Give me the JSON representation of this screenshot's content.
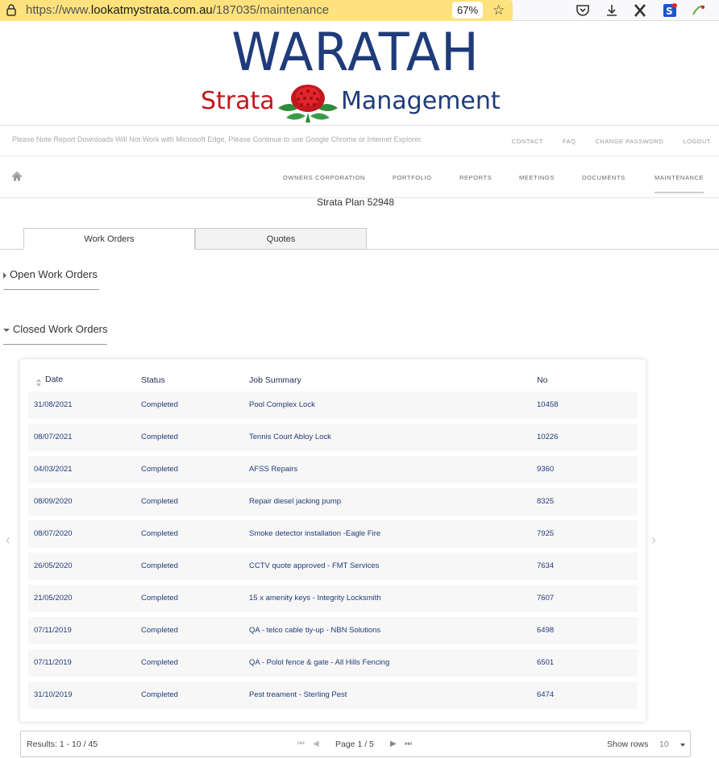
{
  "browser": {
    "url_prefix": "https://www.",
    "url_host": "lookatmystrata.com.au",
    "url_path": "/187035/maintenance",
    "zoom": "67%"
  },
  "logo": {
    "line1": "WARATAH",
    "strata": "Strata",
    "management": "Management"
  },
  "notice": "Please Note Report Downloads Will Not Work with Microsoft Edge, Please Continue to use Google Chrome or Internet Explorer.",
  "top_links": [
    "CONTACT",
    "FAQ",
    "CHANGE PASSWORD",
    "LOGOUT"
  ],
  "nav": {
    "items": [
      "OWNERS CORPORATION",
      "PORTFOLIO",
      "REPORTS",
      "MEETINGS",
      "DOCUMENTS",
      "MAINTENANCE"
    ],
    "active": "MAINTENANCE"
  },
  "plan_title": "Strata Plan 52948",
  "tabs": [
    "Work Orders",
    "Quotes"
  ],
  "sections": {
    "open": "Open Work Orders",
    "closed": "Closed Work Orders"
  },
  "table": {
    "headers": [
      "Date",
      "Status",
      "Job Summary",
      "No"
    ],
    "rows": [
      [
        "31/08/2021",
        "Completed",
        "Pool Complex Lock",
        "10458"
      ],
      [
        "08/07/2021",
        "Completed",
        "Tennis Court Abloy Lock",
        "10226"
      ],
      [
        "04/03/2021",
        "Completed",
        "AFSS Repairs",
        "9360"
      ],
      [
        "08/09/2020",
        "Completed",
        "Repair diesel jacking pump",
        "8325"
      ],
      [
        "08/07/2020",
        "Completed",
        "Smoke detector installation -Eagle Fire",
        "7925"
      ],
      [
        "26/05/2020",
        "Completed",
        "CCTV quote approved - FMT Services",
        "7634"
      ],
      [
        "21/05/2020",
        "Completed",
        "15 x amenity keys - Integrity Locksmith",
        "7607"
      ],
      [
        "07/11/2019",
        "Completed",
        "QA - telco cable tiy-up - NBN Solutions",
        "6498"
      ],
      [
        "07/11/2019",
        "Completed",
        "QA - Polol fence & gate - All Hills Fencing",
        "6501"
      ],
      [
        "31/10/2019",
        "Completed",
        "Pest treament - Sterling Pest",
        "6474"
      ]
    ]
  },
  "pager": {
    "results_label": "Results:",
    "results_value": "1 - 10 / 45",
    "page_label": "Page",
    "page_value": "1 / 5",
    "show_rows_label": "Show rows",
    "rows_value": "10"
  },
  "colors": {
    "url_highlight": "#fde27d",
    "brand_blue": "#1f3b7a",
    "brand_red": "#c4161c"
  }
}
